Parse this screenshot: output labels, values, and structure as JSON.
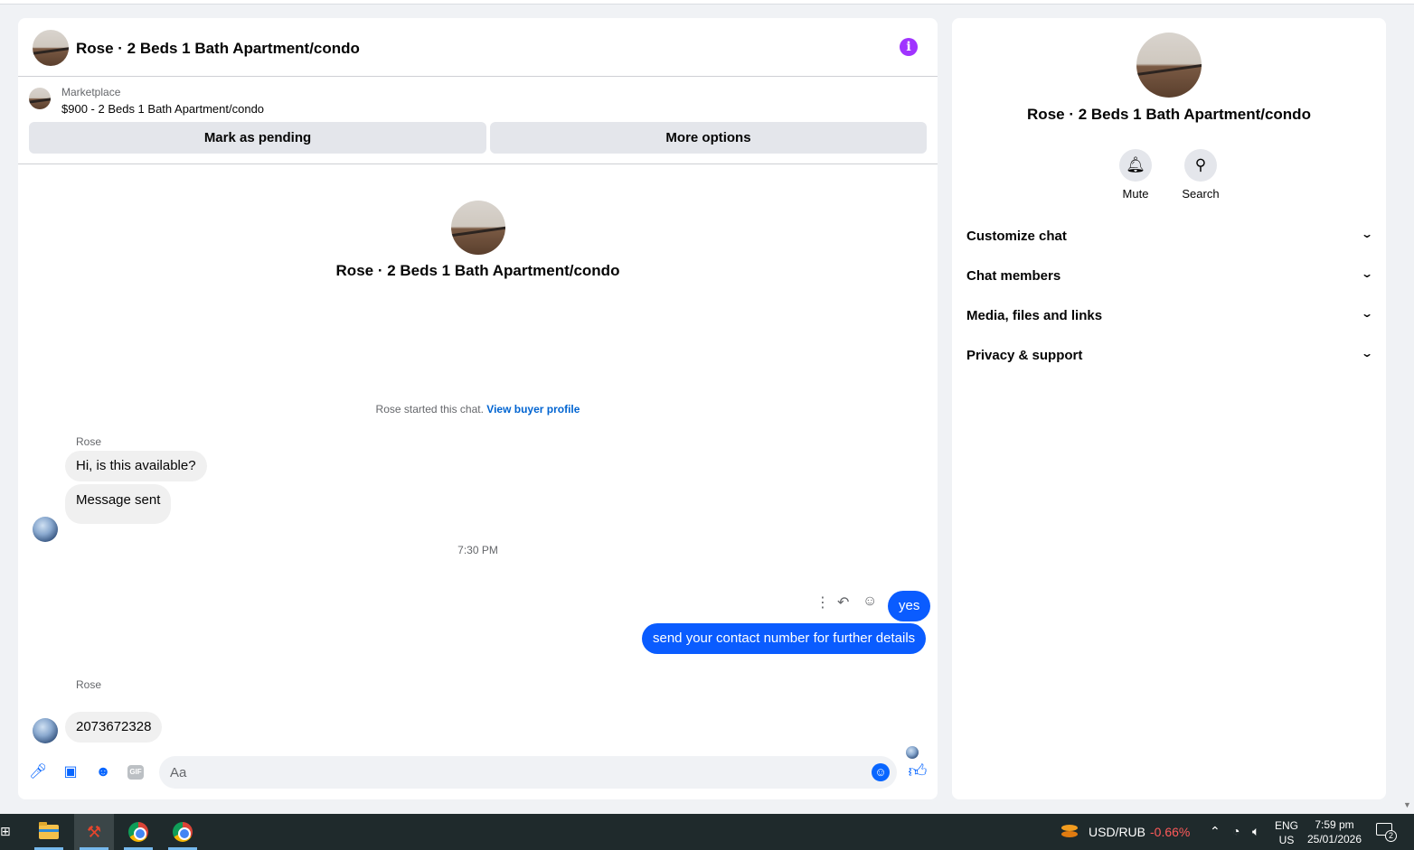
{
  "chat": {
    "title": "Rose · 2 Beds 1 Bath Apartment/condo",
    "marketplace": {
      "label": "Marketplace",
      "listing": "$900 - 2 Beds 1 Bath Apartment/condo",
      "btn_pending": "Mark as pending",
      "btn_more": "More options"
    },
    "intro_title": "Rose · 2 Beds 1 Bath Apartment/condo",
    "started_text": "Rose started this chat. ",
    "started_link": "View buyer profile",
    "messages": [
      {
        "sender": "Rose",
        "text": "Hi, is this available?",
        "direction": "in"
      },
      {
        "sender": "",
        "text": "Message sent",
        "direction": "in"
      },
      {
        "timestamp": "7:30 PM"
      },
      {
        "text": "yes",
        "direction": "out"
      },
      {
        "text": "send your contact number for further details",
        "direction": "out"
      },
      {
        "sender": "Rose",
        "text": "2073672328",
        "direction": "in"
      }
    ],
    "composer": {
      "placeholder": "Aa",
      "gif_label": "GIF"
    }
  },
  "info_panel": {
    "title": "Rose · 2 Beds 1 Bath Apartment/condo",
    "actions": [
      {
        "label": "Mute",
        "icon": "bell-icon"
      },
      {
        "label": "Search",
        "icon": "search-icon"
      }
    ],
    "sections": [
      {
        "label": "Customize chat"
      },
      {
        "label": "Chat members"
      },
      {
        "label": "Media, files and links"
      },
      {
        "label": "Privacy & support"
      }
    ]
  },
  "taskbar": {
    "ticker_name": "USD/RUB",
    "ticker_change": "-0.66%",
    "lang_top": "ENG",
    "lang_bottom": "US",
    "time": "7:59 pm",
    "date": "25/01/2026",
    "notification_count": "2"
  },
  "colors": {
    "accent": "#0866ff",
    "bubble_out": "#0a5cff",
    "info_icon": "#a033ff",
    "negative": "#ff5a5a"
  }
}
